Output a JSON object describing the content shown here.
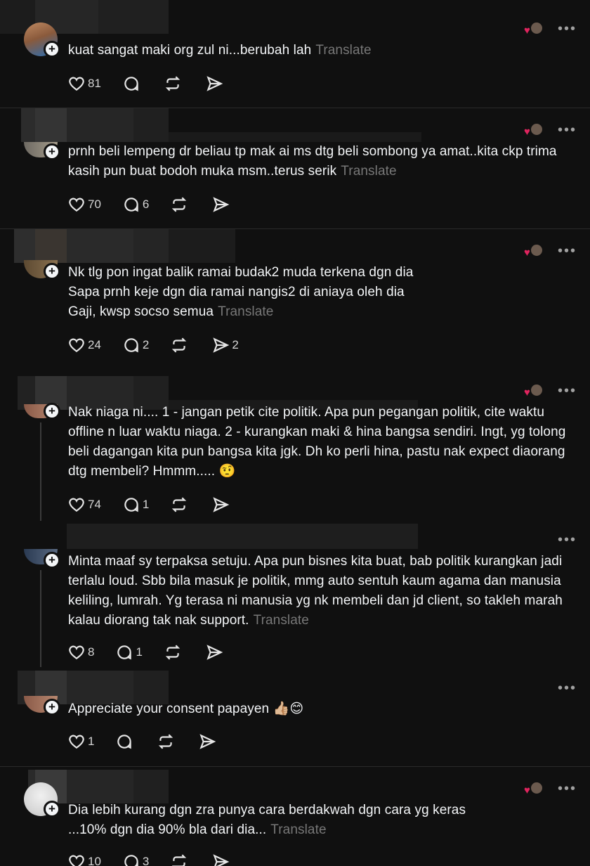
{
  "ui": {
    "translate_label": "Translate",
    "menu_glyph": "•••",
    "colors": {
      "background": "#101010",
      "text": "#f3f5f7",
      "muted": "#777777",
      "heart": "#e0245e"
    }
  },
  "posts": [
    {
      "text": "kuat sangat maki org zul ni...berubah lah",
      "show_translate": true,
      "likes": "81",
      "replies": "",
      "reposts": "",
      "shares": "",
      "liked_by_author": true
    },
    {
      "text": "prnh beli lempeng dr beliau tp mak ai ms dtg beli sombong ya amat..kita ckp trima kasih pun buat bodoh muka msm..terus serik",
      "show_translate": true,
      "likes": "70",
      "replies": "6",
      "reposts": "",
      "shares": "",
      "liked_by_author": true
    },
    {
      "text_lines": [
        "Nk tlg pon ingat balik ramai budak2 muda terkena dgn dia",
        "Sapa prnh keje dgn dia ramai nangis2 di aniaya oleh dia",
        "Gaji, kwsp socso semua"
      ],
      "show_translate": true,
      "likes": "24",
      "replies": "2",
      "reposts": "",
      "shares": "2",
      "liked_by_author": true
    },
    {
      "text": "Nak niaga ni.... 1 - jangan petik cite politik. Apa pun pegangan politik, cite waktu offline n luar waktu niaga. 2 - kurangkan maki & hina bangsa sendiri. Ingt, yg tolong beli dagangan kita pun bangsa kita jgk. Dh ko perli hina, pastu nak expect diaorang dtg membeli? Hmmm..... 🤨",
      "show_translate": false,
      "likes": "74",
      "replies": "1",
      "reposts": "",
      "shares": "",
      "liked_by_author": true
    },
    {
      "text": "Minta maaf sy terpaksa setuju. Apa pun bisnes kita buat, bab politik kurangkan jadi terlalu loud. Sbb bila masuk je politik, mmg auto sentuh kaum agama dan manusia keliling, lumrah. Yg terasa ni manusia yg nk membeli dan jd client, so takleh marah kalau diorang tak nak support.",
      "show_translate": true,
      "likes": "8",
      "replies": "1",
      "reposts": "",
      "shares": "",
      "liked_by_author": false
    },
    {
      "text": "Appreciate your consent papayen 👍🏼😊",
      "show_translate": false,
      "likes": "1",
      "replies": "",
      "reposts": "",
      "shares": "",
      "liked_by_author": false
    },
    {
      "text_lines": [
        "Dia lebih kurang dgn zra punya cara berdakwah dgn cara yg keras",
        "...10% dgn dia 90% bla dari dia..."
      ],
      "show_translate": true,
      "likes": "10",
      "replies": "3",
      "reposts": "",
      "shares": "",
      "liked_by_author": true
    }
  ]
}
